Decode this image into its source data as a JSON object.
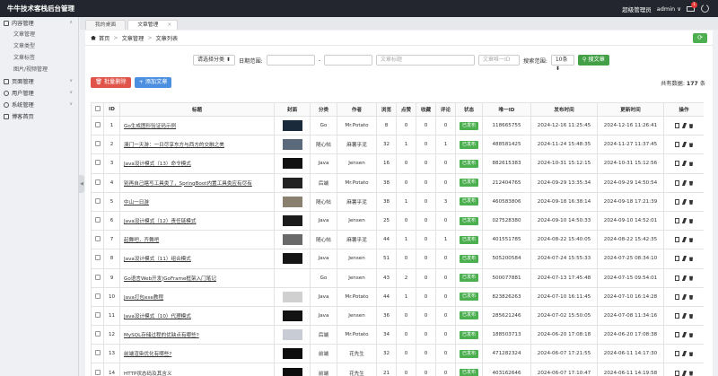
{
  "header": {
    "brand": "牛牛技术客栈后台管理",
    "role": "超级管理员",
    "user": "admin ∨",
    "mail_count": "1"
  },
  "sidebar": {
    "groups": [
      {
        "label": "内容管理",
        "expanded": true,
        "chev": "∧",
        "items": [
          "文章管理",
          "文章类型",
          "文章标签",
          "图片/视频管理"
        ]
      },
      {
        "label": "页面管理",
        "chev": "∨"
      },
      {
        "label": "用户管理",
        "chev": "∨"
      },
      {
        "label": "系统管理",
        "chev": "∨"
      },
      {
        "label": "博客首页"
      }
    ]
  },
  "tabs": [
    {
      "label": "我的桌面"
    },
    {
      "label": "文章管理",
      "close": "×"
    }
  ],
  "breadcrumb": {
    "home": "首页",
    "level1": "文章管理",
    "level2": "文章列表",
    "refresh": "⟳"
  },
  "filters": {
    "category": "请选择分类 ⬍",
    "date_label": "日期范围:",
    "date_dash": "-",
    "title_placeholder": "文章标题",
    "id_placeholder": "文章唯一ID",
    "search_range_label": "搜索范围:",
    "range_value": "10条 ⬍",
    "search_button": "搜文章"
  },
  "actions": {
    "batch_delete": "批量删除",
    "add": "添加文章"
  },
  "total": {
    "label": "共有数据:",
    "count": "177",
    "unit": "条"
  },
  "colors": {
    "green": "#4caf50",
    "red": "#e0544a",
    "blue": "#4c8fe0"
  },
  "table": {
    "columns": [
      "",
      "ID",
      "标题",
      "封面",
      "分类",
      "作者",
      "浏览",
      "点赞",
      "收藏",
      "评论",
      "状态",
      "唯一ID",
      "发布时间",
      "更新时间",
      "操作"
    ],
    "rows": [
      {
        "id": "1",
        "title": "Go生成图形验证码示例",
        "cover": "#1a2a3a",
        "cat": "Go",
        "author": "Mr.Potato",
        "views": "8",
        "likes": "0",
        "fav": "0",
        "comments": "0",
        "status": "已发布",
        "uid": "118665755",
        "pub": "2024-12-16 11:25:45",
        "upd": "2024-12-16 11:26:41"
      },
      {
        "id": "2",
        "title": "澳门一天游：一日尽享东方与西方的交融之美",
        "cover": "#5a6a7a",
        "cat": "随心帖",
        "author": "麻薯乎泥",
        "views": "32",
        "likes": "1",
        "fav": "0",
        "comments": "1",
        "status": "已发布",
        "uid": "488581425",
        "pub": "2024-11-24 15:48:35",
        "upd": "2024-11-27 11:37:45"
      },
      {
        "id": "3",
        "title": "Java设计模式（13）命令模式",
        "cover": "#111111",
        "cat": "Java",
        "author": "Jensen",
        "views": "16",
        "likes": "0",
        "fav": "0",
        "comments": "0",
        "status": "已发布",
        "uid": "882615383",
        "pub": "2024-10-31 15:12:15",
        "upd": "2024-10-31 15:12:56"
      },
      {
        "id": "4",
        "title": "别再自己瞎写工具类了，SpringBoot内置工具类应有尽有",
        "cover": "#222222",
        "cat": "后端",
        "author": "Mr.Potato",
        "views": "38",
        "likes": "0",
        "fav": "0",
        "comments": "0",
        "status": "已发布",
        "uid": "212404765",
        "pub": "2024-09-29 13:35:34",
        "upd": "2024-09-29 14:50:54"
      },
      {
        "id": "5",
        "title": "中山一日游",
        "cover": "#8a8070",
        "cat": "随心帖",
        "author": "麻薯乎泥",
        "views": "38",
        "likes": "1",
        "fav": "0",
        "comments": "3",
        "status": "已发布",
        "uid": "460583806",
        "pub": "2024-09-18 16:38:14",
        "upd": "2024-09-18 17:21:39"
      },
      {
        "id": "6",
        "title": "Java设计模式（12）责任链模式",
        "cover": "#1b1b1b",
        "cat": "Java",
        "author": "Jensen",
        "views": "25",
        "likes": "0",
        "fav": "0",
        "comments": "0",
        "status": "已发布",
        "uid": "027528380",
        "pub": "2024-09-10 14:50:33",
        "upd": "2024-09-10 14:52:01"
      },
      {
        "id": "7",
        "title": "起舞吧，齐舞吧",
        "cover": "#6a6a6a",
        "cat": "随心帖",
        "author": "麻薯乎泥",
        "views": "44",
        "likes": "1",
        "fav": "0",
        "comments": "1",
        "status": "已发布",
        "uid": "401551785",
        "pub": "2024-08-22 15:40:05",
        "upd": "2024-08-22 15:42:35"
      },
      {
        "id": "8",
        "title": "Java设计模式（11）组合模式",
        "cover": "#151515",
        "cat": "Java",
        "author": "Jensen",
        "views": "51",
        "likes": "0",
        "fav": "0",
        "comments": "0",
        "status": "已发布",
        "uid": "505200584",
        "pub": "2024-07-24 15:55:33",
        "upd": "2024-07-25 08:34:10"
      },
      {
        "id": "9",
        "title": "Go语言Web开发|GoFrame框架入门笔记",
        "cover": "#ffffff",
        "cat": "Go",
        "author": "Jensen",
        "views": "43",
        "likes": "2",
        "fav": "0",
        "comments": "0",
        "status": "已发布",
        "uid": "500077881",
        "pub": "2024-07-13 17:45:48",
        "upd": "2024-07-15 09:54:01"
      },
      {
        "id": "10",
        "title": "Java打包exe教程",
        "cover": "#d0d0d0",
        "cat": "Java",
        "author": "Mr.Potato",
        "views": "44",
        "likes": "1",
        "fav": "0",
        "comments": "0",
        "status": "已发布",
        "uid": "823826263",
        "pub": "2024-07-10 16:11:45",
        "upd": "2024-07-10 16:14:28"
      },
      {
        "id": "11",
        "title": "Java设计模式（10）代理模式",
        "cover": "#121212",
        "cat": "Java",
        "author": "Jensen",
        "views": "36",
        "likes": "0",
        "fav": "0",
        "comments": "0",
        "status": "已发布",
        "uid": "285621246",
        "pub": "2024-07-02 15:50:05",
        "upd": "2024-07-08 11:34:16"
      },
      {
        "id": "12",
        "title": "MySQL存储过程的优缺点有哪些?",
        "cover": "#c8ccd4",
        "cat": "后端",
        "author": "Mr.Potato",
        "views": "34",
        "likes": "0",
        "fav": "0",
        "comments": "0",
        "status": "已发布",
        "uid": "188503713",
        "pub": "2024-06-20 17:08:18",
        "upd": "2024-06-20 17:08:38"
      },
      {
        "id": "13",
        "title": "前端渲染优化有哪些?",
        "cover": "#0e0e0e",
        "cat": "前端",
        "author": "花先生",
        "views": "32",
        "likes": "0",
        "fav": "0",
        "comments": "0",
        "status": "已发布",
        "uid": "471282324",
        "pub": "2024-06-07 17:21:55",
        "upd": "2024-06-11 14:17:30"
      },
      {
        "id": "14",
        "title": "HTTP状态码及其含义",
        "cover": "#0e0e0e",
        "cat": "前端",
        "author": "花先生",
        "views": "21",
        "likes": "0",
        "fav": "0",
        "comments": "0",
        "status": "已发布",
        "uid": "403162646",
        "pub": "2024-06-07 17:10:47",
        "upd": "2024-06-11 14:19:58"
      }
    ]
  }
}
